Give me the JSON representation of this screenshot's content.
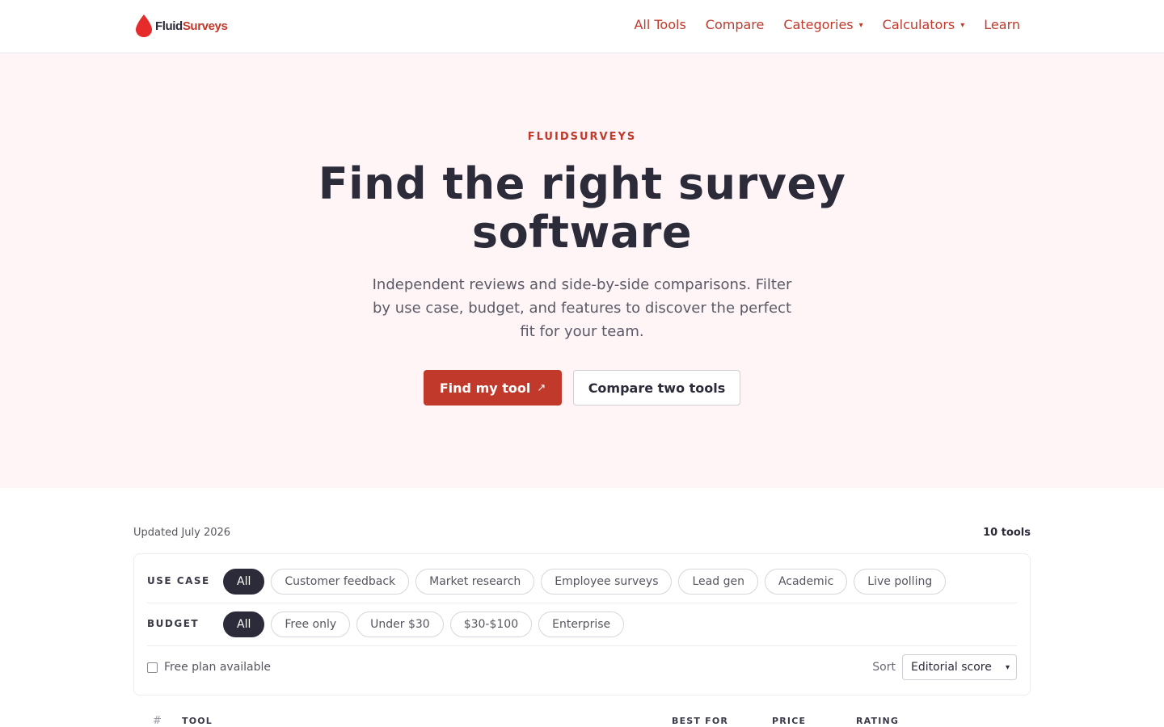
{
  "header": {
    "logo_word_a": "Fluid",
    "logo_word_b": "Surveys",
    "nav": [
      {
        "label": "All Tools",
        "dropdown": false
      },
      {
        "label": "Compare",
        "dropdown": false
      },
      {
        "label": "Categories",
        "dropdown": true
      },
      {
        "label": "Calculators",
        "dropdown": true
      },
      {
        "label": "Learn",
        "dropdown": false
      }
    ],
    "caret": "▾"
  },
  "hero": {
    "eyebrow": "FLUIDSURVEYS",
    "title": "Find the right survey software",
    "subtitle": "Independent reviews and side-by-side comparisons. Filter by use case, budget, and features to discover the perfect fit for your team.",
    "primary_cta": "Find my tool",
    "primary_cta_icon": "↗",
    "secondary_cta": "Compare two tools"
  },
  "listing": {
    "updated": "Updated July 2026",
    "count": "10 tools",
    "filters": {
      "use_case": {
        "label": "USE CASE",
        "options": [
          "All",
          "Customer feedback",
          "Market research",
          "Employee surveys",
          "Lead gen",
          "Academic",
          "Live polling"
        ],
        "selected": "All"
      },
      "budget": {
        "label": "BUDGET",
        "options": [
          "All",
          "Free only",
          "Under $30",
          "$30-$100",
          "Enterprise"
        ],
        "selected": "All"
      },
      "free_plan": {
        "label": "Free plan available",
        "checked": false
      },
      "sort": {
        "label": "Sort",
        "value": "Editorial score"
      }
    },
    "table_headers": {
      "num": "#",
      "tool": "TOOL",
      "best_for": "BEST FOR",
      "price": "PRICE",
      "rating": "RATING"
    }
  },
  "colors": {
    "accent": "#c0392b",
    "dark": "#2b2b3a",
    "hero_bg": "#fff4f6"
  },
  "icons": {
    "logo": "droplet-icon",
    "dropdown": "chevron-down-icon",
    "cta": "external-arrow-icon"
  }
}
